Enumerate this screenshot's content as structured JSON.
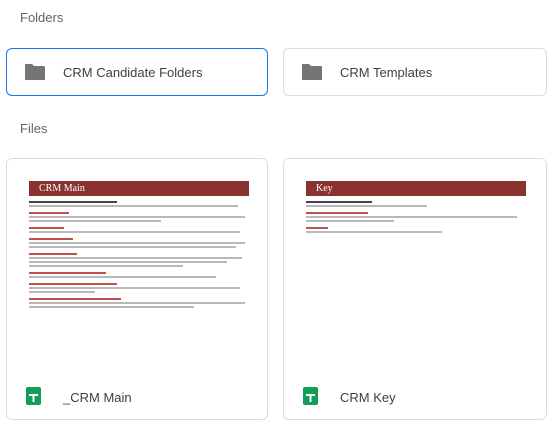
{
  "sections": {
    "folders_label": "Folders",
    "files_label": "Files"
  },
  "folders": [
    {
      "name": "CRM Candidate Folders",
      "icon": "folder-icon",
      "selected": true
    },
    {
      "name": "CRM Templates",
      "icon": "folder-icon",
      "selected": false
    }
  ],
  "files": [
    {
      "name": "_CRM Main",
      "icon": "google-sheets-icon",
      "thumbnail_title": "CRM Main"
    },
    {
      "name": "CRM Key",
      "icon": "google-sheets-icon",
      "thumbnail_title": "Key"
    }
  ],
  "colors": {
    "folder_icon": "#757575",
    "selected_border": "#1a73e8",
    "sheets_green": "#0f9d58",
    "doc_banner": "#8a3230"
  }
}
